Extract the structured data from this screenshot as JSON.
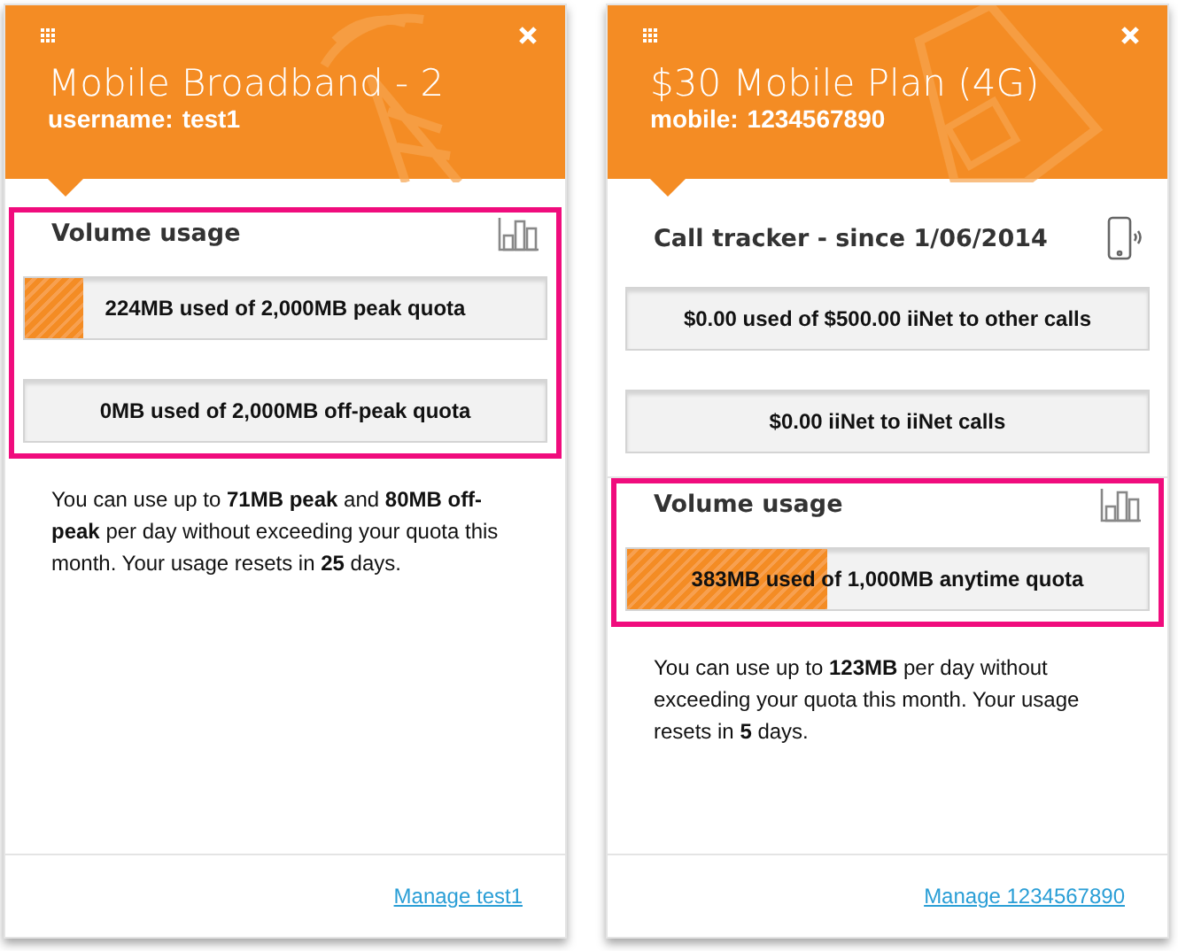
{
  "cards": [
    {
      "kind": "broadband",
      "title": "Mobile Broadband - 2",
      "subtitle_label": "username:",
      "subtitle_value": "test1",
      "sections": [
        {
          "kind": "usage",
          "title": "Volume usage",
          "highlighted": true,
          "bars": [
            {
              "text": "224MB used of 2,000MB peak quota",
              "level": 0.112
            },
            {
              "text": "0MB used of 2,000MB off-peak quota"
            }
          ]
        }
      ],
      "note": "You can use up to **71MB peak** and **80MB off-peak** per day without exceeding your quota this month. Your usage resets in **25** days.",
      "manage_link": "Manage test1"
    },
    {
      "kind": "mobile",
      "title": "$30 Mobile Plan (4G)",
      "subtitle_label": "mobile:",
      "subtitle_value": "1234567890",
      "sections": [
        {
          "kind": "calls",
          "title": "Call tracker - since 1/06/2014",
          "highlighted": false,
          "bars": [
            {
              "text": "$0.00 used of $500.00 iiNet to other calls"
            },
            {
              "text": "$0.00 iiNet to iiNet calls"
            }
          ]
        },
        {
          "kind": "usage",
          "title": "Volume usage",
          "highlighted": true,
          "bars": [
            {
              "text": "383MB used of 1,000MB anytime quota",
              "level": 0.383
            }
          ]
        }
      ],
      "note": "You can use up to **123MB** per day without exceeding your quota this month. Your usage resets in **5** days.",
      "manage_link": "Manage 1234567890"
    }
  ]
}
